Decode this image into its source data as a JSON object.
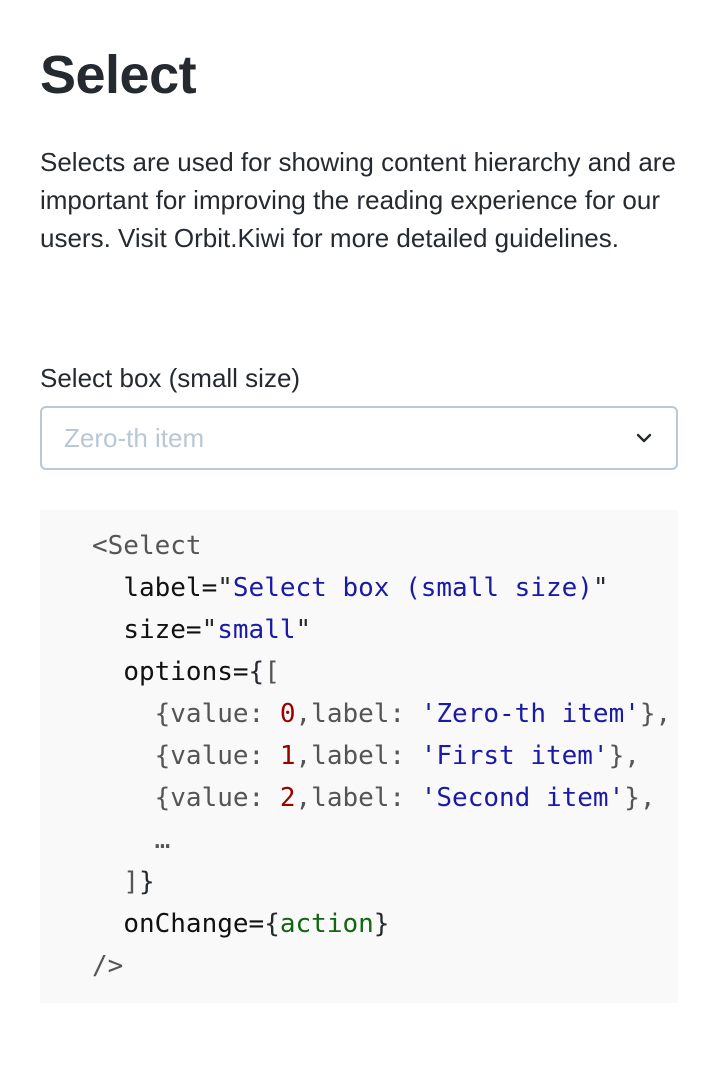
{
  "page": {
    "title": "Select",
    "description": "Selects are used for showing content hierarchy and are important for improving the reading experience for our users. Visit Orbit.Kiwi for more detailed guidelines."
  },
  "select": {
    "label": "Select box (small size)",
    "value": "Zero-th item",
    "icon": "chevron-down-icon"
  },
  "code": {
    "line1": "<Select",
    "attr_label_name": "label=",
    "attr_label_value": "Select box (small size)",
    "attr_size_name": "size=",
    "attr_size_value": "small",
    "attr_options_name": "options=",
    "options": [
      {
        "value": "0",
        "label": "'Zero-th item'"
      },
      {
        "value": "1",
        "label": "'First item'"
      },
      {
        "value": "2",
        "label": "'Second item'"
      }
    ],
    "ellipsis": "…",
    "attr_onchange_name": "onChange=",
    "attr_onchange_value": "action",
    "closing": "/>"
  },
  "colors": {
    "text": "#252a31",
    "placeholder": "#bac7d5",
    "border": "#bac7d5",
    "code_background": "#f9f9f9",
    "code_string": "#1a1aa6",
    "code_number": "#990000",
    "code_identifier": "#116611"
  }
}
